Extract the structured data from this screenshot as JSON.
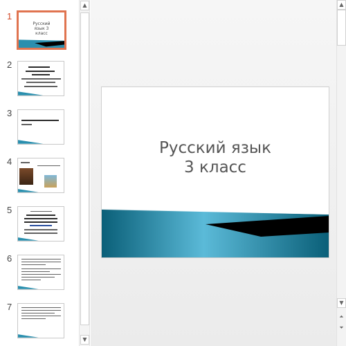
{
  "thumbnails": {
    "slides": [
      {
        "number": "1",
        "text": "Русский язык 3 класс",
        "selected": true
      },
      {
        "number": "2",
        "selected": false
      },
      {
        "number": "3",
        "selected": false
      },
      {
        "number": "4",
        "selected": false
      },
      {
        "number": "5",
        "selected": false
      },
      {
        "number": "6",
        "selected": false
      },
      {
        "number": "7",
        "selected": false
      }
    ]
  },
  "slide": {
    "title_line1": "Русский язык",
    "title_line2": "3 класс",
    "colors": {
      "wave_dark": "#0a5f78",
      "wave_light": "#5bbad8",
      "band": "#000000"
    }
  },
  "colors": {
    "accent": "#e07450",
    "active_number": "#d24726"
  },
  "icons": {
    "scroll_up": "triangle-up",
    "scroll_down": "triangle-down",
    "prev_slide": "double-triangle-up",
    "next_slide": "double-triangle-down"
  }
}
